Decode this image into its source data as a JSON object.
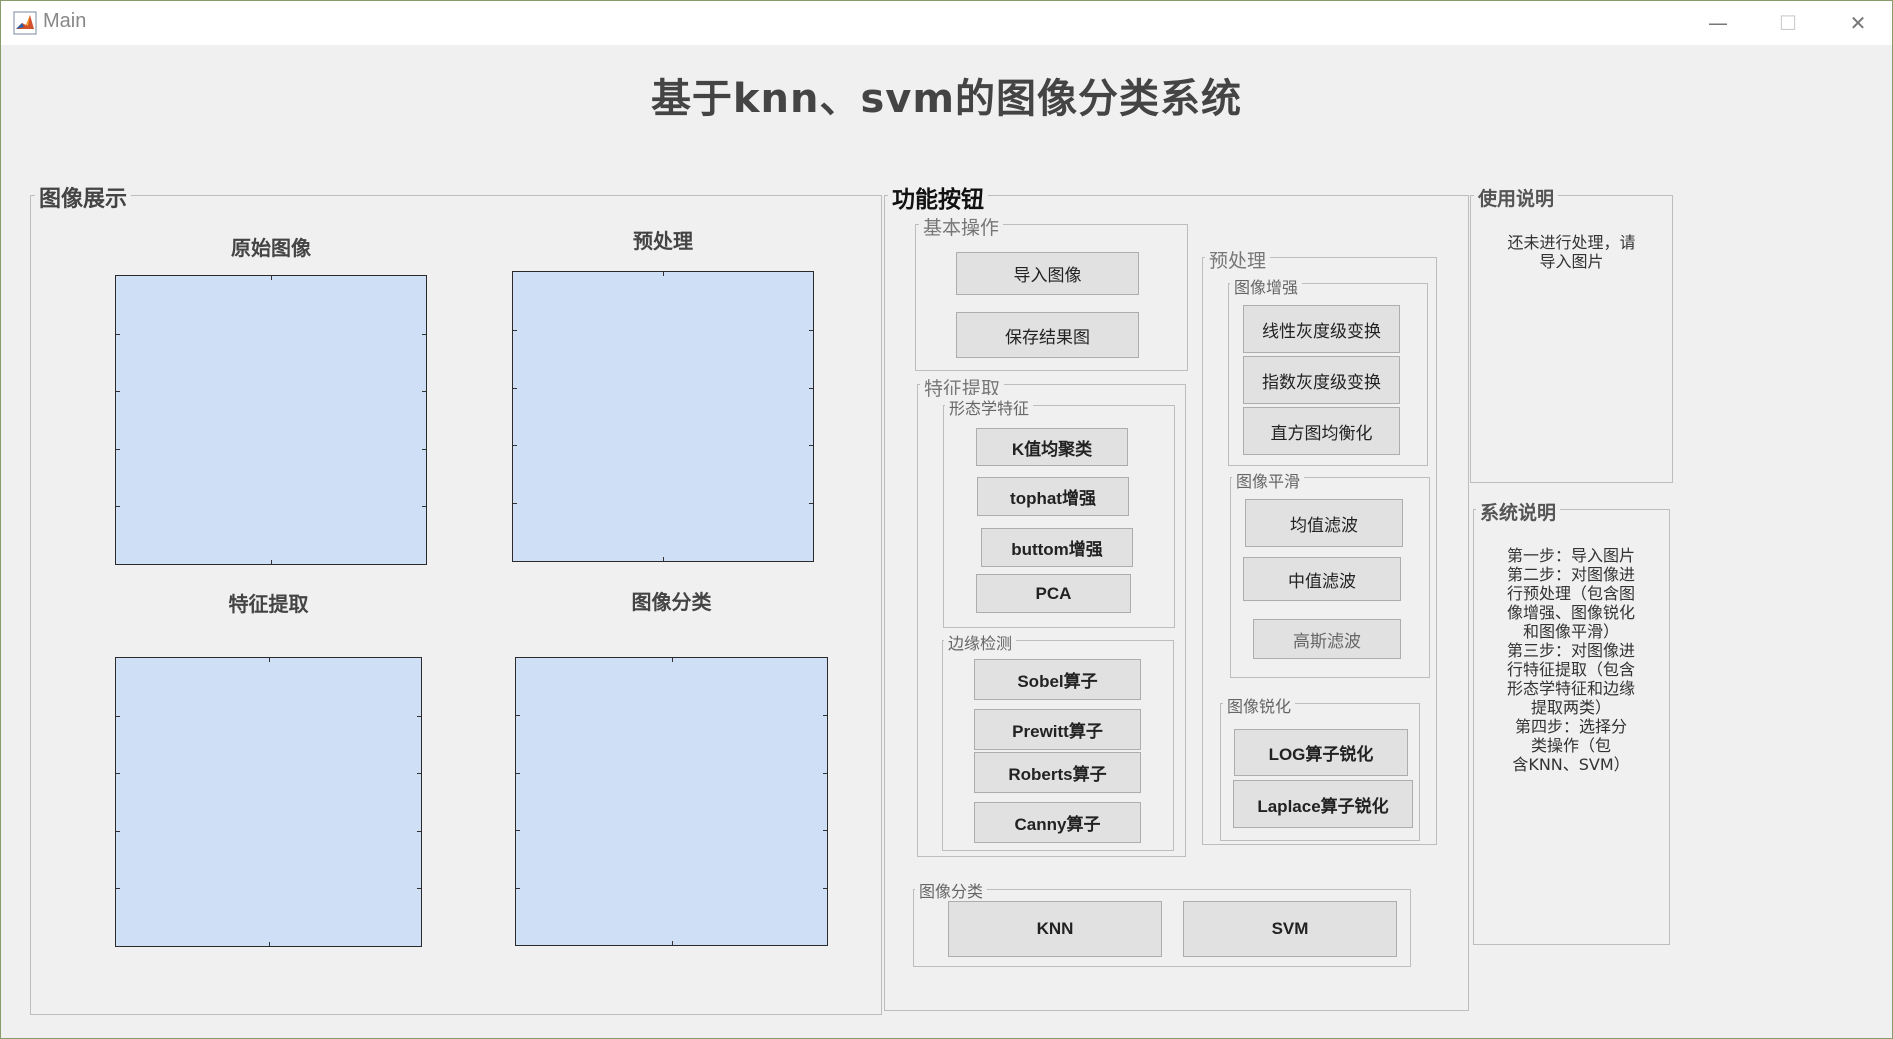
{
  "window": {
    "title": "Main",
    "minimize_glyph": "—",
    "maximize_glyph": "☐",
    "close_glyph": "✕"
  },
  "main_title": "基于knn、svm的图像分类系统",
  "display_panel": {
    "title": "图像展示",
    "axes": [
      {
        "title": "原始图像"
      },
      {
        "title": "预处理"
      },
      {
        "title": "特征提取"
      },
      {
        "title": "图像分类"
      }
    ]
  },
  "function_panel": {
    "title": "功能按钮",
    "basic": {
      "title": "基本操作",
      "import_label": "导入图像",
      "save_label": "保存结果图"
    },
    "feature": {
      "title": "特征提取",
      "morph": {
        "title": "形态学特征",
        "kmeans_label": "K值均聚类",
        "tophat_label": "tophat增强",
        "buttom_label": "buttom增强",
        "pca_label": "PCA"
      },
      "edge": {
        "title": "边缘检测",
        "sobel_label": "Sobel算子",
        "prewitt_label": "Prewitt算子",
        "roberts_label": "Roberts算子",
        "canny_label": "Canny算子"
      }
    },
    "preprocess": {
      "title": "预处理",
      "enhance": {
        "title": "图像增强",
        "linear_label": "线性灰度级变换",
        "exp_label": "指数灰度级变换",
        "hist_label": "直方图均衡化"
      },
      "smooth": {
        "title": "图像平滑",
        "mean_label": "均值滤波",
        "median_label": "中值滤波",
        "gauss_label": "高斯滤波"
      },
      "sharpen": {
        "title": "图像锐化",
        "log_label": "LOG算子锐化",
        "laplace_label": "Laplace算子锐化"
      }
    },
    "classify": {
      "title": "图像分类",
      "knn_label": "KNN",
      "svm_label": "SVM"
    }
  },
  "usage_panel": {
    "title": "使用说明",
    "text": "还未进行处理，请\n导入图片"
  },
  "system_panel": {
    "title": "系统说明",
    "text": "第一步：导入图片\n第二步：对图像进\n行预处理（包含图\n像增强、图像锐化\n和图像平滑）\n第三步：对图像进\n行特征提取（包含\n形态学特征和边缘\n提取两类）\n第四步：选择分\n类操作（包\n含KNN、SVM）"
  },
  "colors": {
    "axes_bg": "#cfdff5",
    "button_bg": "#e1e1e1",
    "window_bg": "#f0f0f0"
  }
}
